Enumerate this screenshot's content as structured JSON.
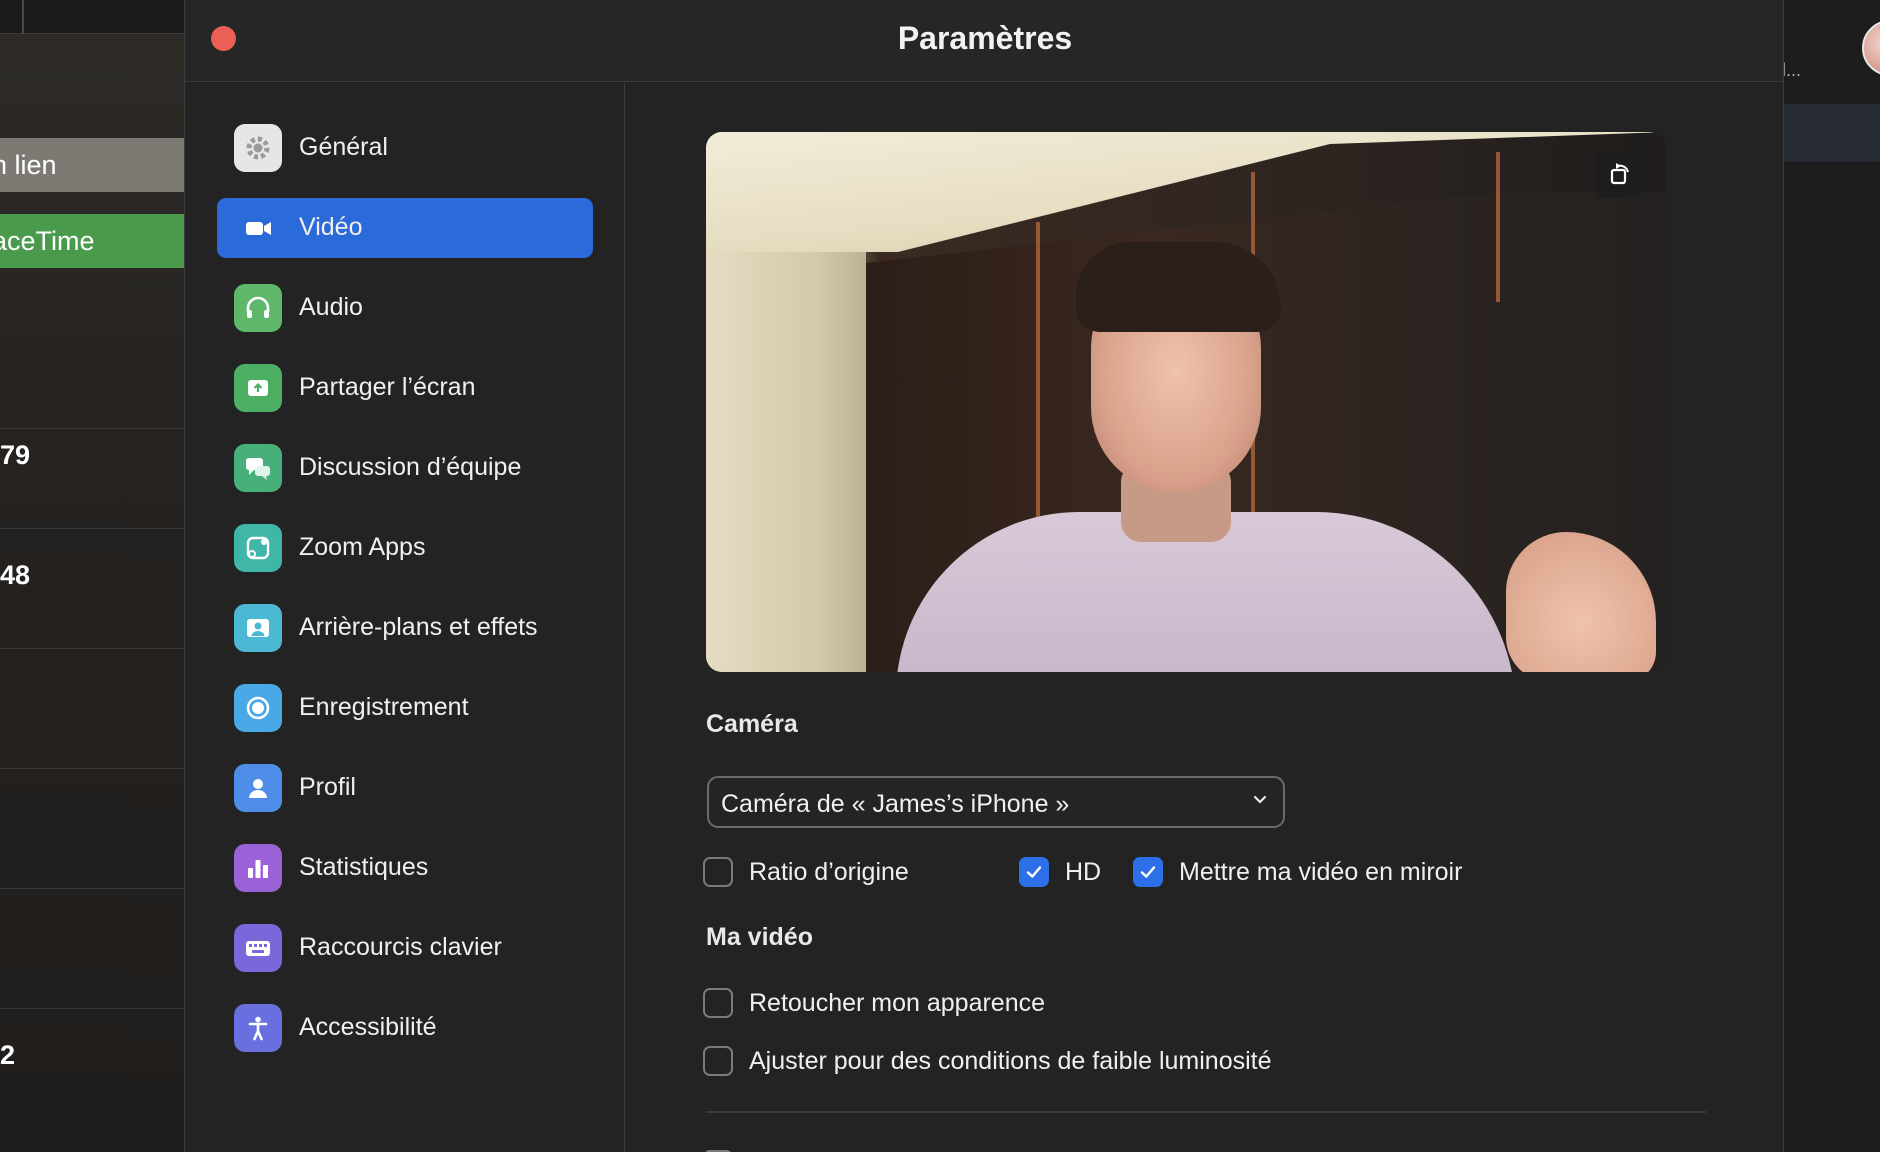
{
  "background_app": {
    "pill_link": "n lien",
    "pill_facetime": "aceTime",
    "numbers": [
      "79",
      "48",
      "2"
    ],
    "right_dots": "l..."
  },
  "window": {
    "title": "Paramètres"
  },
  "sidebar": {
    "items": [
      {
        "label": "Général",
        "icon": "gear-icon",
        "color": "#e6e6e6"
      },
      {
        "label": "Vidéo",
        "icon": "video-camera-icon",
        "color": "#2a6ad9"
      },
      {
        "label": "Audio",
        "icon": "headphones-icon",
        "color": "#5fb86a"
      },
      {
        "label": "Partager l’écran",
        "icon": "share-screen-icon",
        "color": "#4caf63"
      },
      {
        "label": "Discussion d’équipe",
        "icon": "chat-bubbles-icon",
        "color": "#47b07a"
      },
      {
        "label": "Zoom Apps",
        "icon": "apps-icon",
        "color": "#3fb6a8"
      },
      {
        "label": "Arrière-plans et effets",
        "icon": "background-portrait-icon",
        "color": "#4bb9d4"
      },
      {
        "label": "Enregistrement",
        "icon": "record-icon",
        "color": "#48a9e6"
      },
      {
        "label": "Profil",
        "icon": "profile-icon",
        "color": "#4f8ee8"
      },
      {
        "label": "Statistiques",
        "icon": "bar-chart-icon",
        "color": "#9a62d6"
      },
      {
        "label": "Raccourcis clavier",
        "icon": "keyboard-icon",
        "color": "#7a67da"
      },
      {
        "label": "Accessibilité",
        "icon": "accessibility-icon",
        "color": "#6a6fe0"
      }
    ],
    "active_index": 1
  },
  "video": {
    "camera_section_title": "Caméra",
    "camera_select_value": "Caméra de « James’s iPhone »",
    "options_row": [
      {
        "label": "Ratio d’origine",
        "checked": false
      },
      {
        "label": "HD",
        "checked": true
      },
      {
        "label": "Mettre ma vidéo en miroir",
        "checked": true
      }
    ],
    "my_video_section_title": "Ma vidéo",
    "my_video_options": [
      {
        "label": "Retoucher mon apparence",
        "checked": false
      },
      {
        "label": "Ajuster pour des conditions de faible luminosité",
        "checked": false
      }
    ]
  },
  "colors": {
    "accent": "#2a6ad9",
    "checkbox_on": "#2d6fe6",
    "close_button": "#ec5f57"
  }
}
